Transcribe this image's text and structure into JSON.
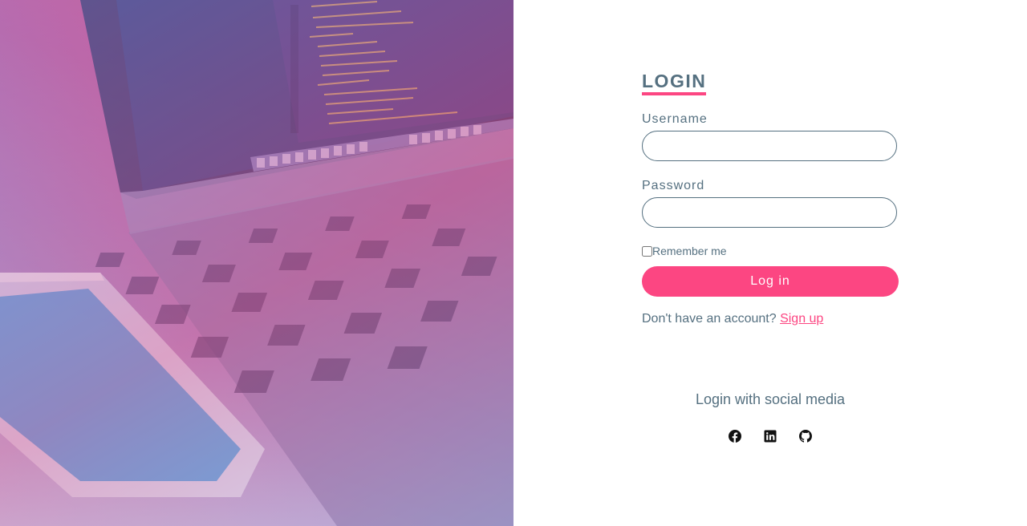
{
  "form": {
    "title": "LOGIN",
    "username_label": "Username",
    "username_value": "",
    "password_label": "Password",
    "password_value": "",
    "remember_label": "Remember me",
    "remember_checked": false,
    "login_button": "Log in",
    "no_account_text": "Don't have an account? ",
    "signup_link": "Sign up"
  },
  "social": {
    "title": "Login with social media",
    "icons": [
      "facebook-icon",
      "linkedin-icon",
      "github-icon"
    ]
  },
  "colors": {
    "accent": "#fc4682",
    "text": "#557080"
  }
}
